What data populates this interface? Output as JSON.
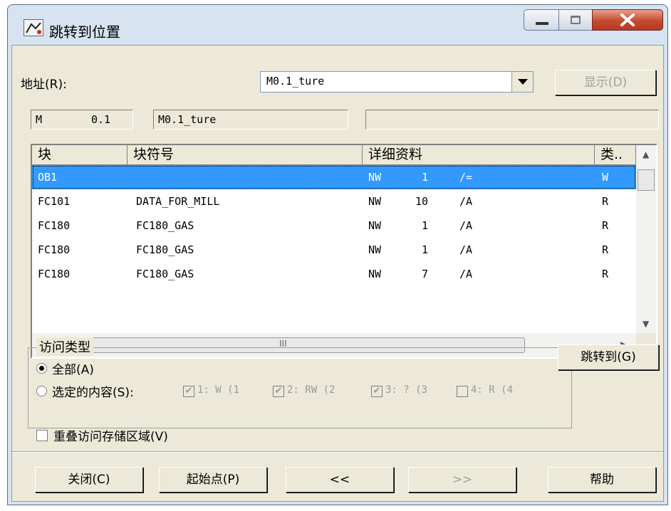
{
  "window": {
    "title": "跳转到位置"
  },
  "address": {
    "label": "地址(R):",
    "combo_value": "M0.1_ture",
    "show_button": "显示(D)",
    "field_type": "M",
    "field_offset": "0.1",
    "field_symbol": "M0.1_ture",
    "field_extra": ""
  },
  "table": {
    "columns": [
      "块",
      "块符号",
      "详细资料",
      "类.."
    ],
    "rows": [
      {
        "block": "OB1",
        "symbol": "",
        "nw": "NW",
        "num": "1",
        "op": "/=",
        "type": "W"
      },
      {
        "block": "FC101",
        "symbol": "DATA_FOR_MILL",
        "nw": "NW",
        "num": "10",
        "op": "/A",
        "type": "R"
      },
      {
        "block": "FC180",
        "symbol": "FC180_GAS",
        "nw": "NW",
        "num": "1",
        "op": "/A",
        "type": "R"
      },
      {
        "block": "FC180",
        "symbol": "FC180_GAS",
        "nw": "NW",
        "num": "1",
        "op": "/A",
        "type": "R"
      },
      {
        "block": "FC180",
        "symbol": "FC180_GAS",
        "nw": "NW",
        "num": "7",
        "op": "/A",
        "type": "R"
      }
    ],
    "hscroll_grip": "III"
  },
  "access": {
    "legend": "访问类型",
    "all_label": "全部(A)",
    "selected_label": "选定的内容(S):",
    "checks": [
      {
        "label": "1: W (1",
        "checked": true
      },
      {
        "label": "2: RW (2",
        "checked": true
      },
      {
        "label": "3: ? (3",
        "checked": true
      },
      {
        "label": "4: R (4",
        "checked": false
      }
    ],
    "goto_button": "跳转到(G)"
  },
  "overlap_label": "重叠访问存储区域(V)",
  "buttons": {
    "close": "关闭(C)",
    "start": "起始点(P)",
    "prev": "<<",
    "next": ">>",
    "help": "帮助"
  }
}
